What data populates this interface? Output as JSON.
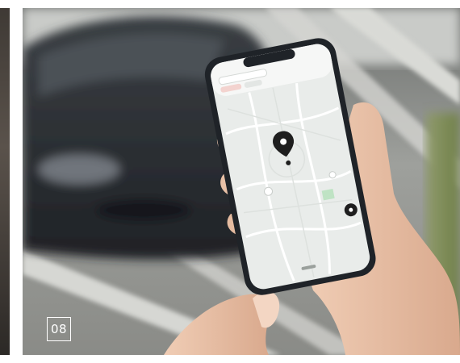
{
  "photo": {
    "frame_number": "08",
    "subject": "hand-holding-phone-with-map-app",
    "icons": [
      "location-pin-icon",
      "user-location-dot-icon",
      "map-marker-icon"
    ]
  },
  "colors": {
    "car_body": "#2a2d31",
    "phone_frame": "#1f2328",
    "map_land": "#e9ecea",
    "map_roads": "#ffffff",
    "map_park": "#bfe3c4",
    "pin": "#1e1e1e",
    "skin": "#e8c3a9"
  }
}
